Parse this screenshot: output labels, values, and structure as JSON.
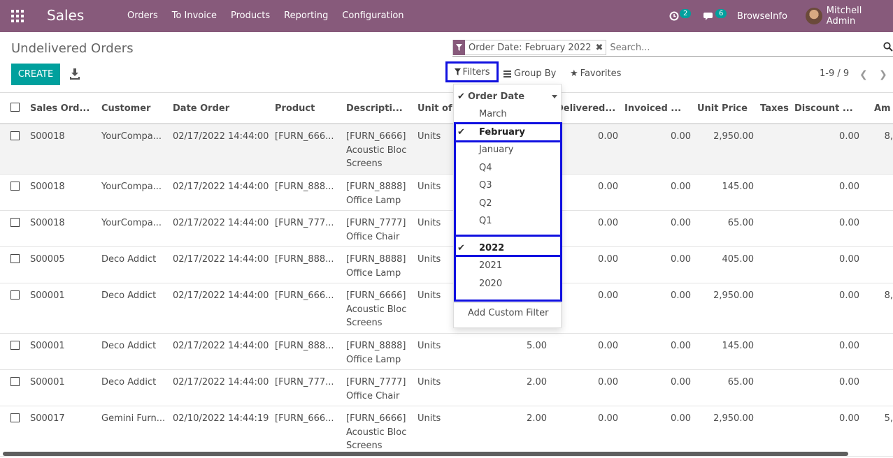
{
  "nav": {
    "brand": "Sales",
    "menu": [
      "Orders",
      "To Invoice",
      "Products",
      "Reporting",
      "Configuration"
    ],
    "activity_count": "2",
    "message_count": "6",
    "company": "BrowseInfo",
    "user": "Mitchell Admin"
  },
  "control": {
    "title": "Undelivered Orders",
    "facet": "Order Date: February 2022",
    "search_placeholder": "Search...",
    "create_label": "CREATE",
    "filters_label": "Filters",
    "groupby_label": "Group By",
    "favorites_label": "Favorites",
    "pager": "1-9 / 9"
  },
  "table": {
    "headers": [
      "Sales Ord...",
      "Customer",
      "Date Order",
      "Product",
      "Descripti...",
      "Unit of",
      "Delivered...",
      "Invoiced ...",
      "Unit Price",
      "Taxes",
      "Discount ...",
      "Am"
    ],
    "rows": [
      {
        "order": "S00018",
        "customer": "YourCompa...",
        "date": "02/17/2022 14:44:00",
        "product": "[FURN_666...",
        "desc1": "[FURN_6666]",
        "desc2": "Acoustic Bloc",
        "desc3": "Screens",
        "uom": "Units",
        "qty": "",
        "delivered": "0.00",
        "invoiced": "0.00",
        "price": "2,950.00",
        "discount": "0.00",
        "amount": "8,"
      },
      {
        "order": "S00018",
        "customer": "YourCompa...",
        "date": "02/17/2022 14:44:00",
        "product": "[FURN_888...",
        "desc1": "[FURN_8888]",
        "desc2": "Office Lamp",
        "desc3": "",
        "uom": "Units",
        "qty": "",
        "delivered": "0.00",
        "invoiced": "0.00",
        "price": "145.00",
        "discount": "0.00",
        "amount": ""
      },
      {
        "order": "S00018",
        "customer": "YourCompa...",
        "date": "02/17/2022 14:44:00",
        "product": "[FURN_777...",
        "desc1": "[FURN_7777]",
        "desc2": "Office Chair",
        "desc3": "",
        "uom": "Units",
        "qty": "",
        "delivered": "0.00",
        "invoiced": "0.00",
        "price": "65.00",
        "discount": "0.00",
        "amount": ""
      },
      {
        "order": "S00005",
        "customer": "Deco Addict",
        "date": "02/17/2022 14:44:00",
        "product": "[FURN_888...",
        "desc1": "[FURN_8888]",
        "desc2": "Office Lamp",
        "desc3": "",
        "uom": "Units",
        "qty": "",
        "delivered": "0.00",
        "invoiced": "0.00",
        "price": "405.00",
        "discount": "0.00",
        "amount": ""
      },
      {
        "order": "S00001",
        "customer": "Deco Addict",
        "date": "02/17/2022 14:44:00",
        "product": "[FURN_666...",
        "desc1": "[FURN_6666]",
        "desc2": "Acoustic Bloc",
        "desc3": "Screens",
        "uom": "Units",
        "qty": "",
        "delivered": "0.00",
        "invoiced": "0.00",
        "price": "2,950.00",
        "discount": "0.00",
        "amount": "8,"
      },
      {
        "order": "S00001",
        "customer": "Deco Addict",
        "date": "02/17/2022 14:44:00",
        "product": "[FURN_888...",
        "desc1": "[FURN_8888]",
        "desc2": "Office Lamp",
        "desc3": "",
        "uom": "Units",
        "qty": "5.00",
        "delivered": "0.00",
        "invoiced": "0.00",
        "price": "145.00",
        "discount": "0.00",
        "amount": ""
      },
      {
        "order": "S00001",
        "customer": "Deco Addict",
        "date": "02/17/2022 14:44:00",
        "product": "[FURN_777...",
        "desc1": "[FURN_7777]",
        "desc2": "Office Chair",
        "desc3": "",
        "uom": "Units",
        "qty": "2.00",
        "delivered": "0.00",
        "invoiced": "0.00",
        "price": "65.00",
        "discount": "0.00",
        "amount": ""
      },
      {
        "order": "S00017",
        "customer": "Gemini Furn...",
        "date": "02/10/2022 14:44:19",
        "product": "[FURN_666...",
        "desc1": "[FURN_6666]",
        "desc2": "Acoustic Bloc",
        "desc3": "Screens",
        "uom": "Units",
        "qty": "2.00",
        "delivered": "0.00",
        "invoiced": "0.00",
        "price": "2,950.00",
        "discount": "0.00",
        "amount": "5,"
      }
    ]
  },
  "dropdown": {
    "header": "Order Date",
    "items": [
      "March",
      "February",
      "January",
      "Q4",
      "Q3",
      "Q2",
      "Q1",
      "2022",
      "2021",
      "2020"
    ],
    "selected": [
      "February",
      "2022"
    ],
    "custom": "Add Custom Filter"
  },
  "colors": {
    "nav": "#875a7b",
    "primary": "#00a09d",
    "highlight_box": "#1010e0"
  }
}
